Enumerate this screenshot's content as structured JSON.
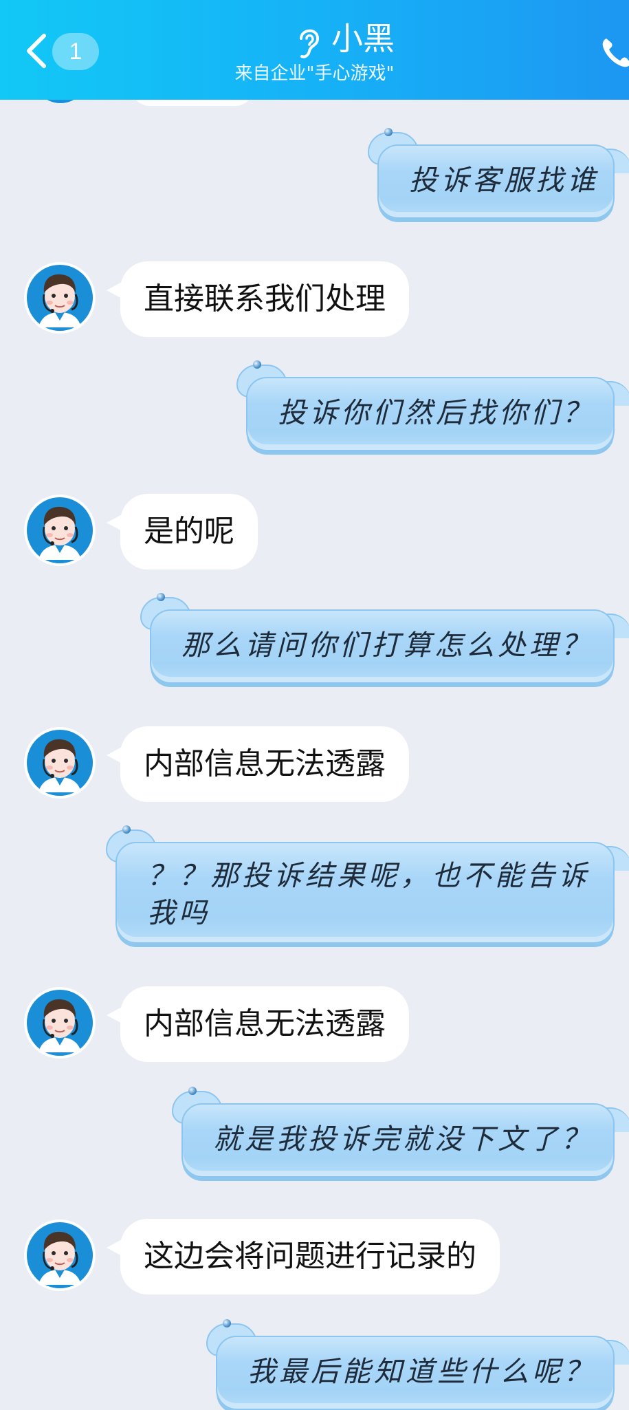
{
  "header": {
    "badge_count": "1",
    "title": "小黑",
    "subtitle": "来自企业\"手心游戏\""
  },
  "messages": [
    {
      "side": "out",
      "text": "投诉客服找谁"
    },
    {
      "side": "in",
      "text": "直接联系我们处理"
    },
    {
      "side": "out",
      "text": "投诉你们然后找你们？"
    },
    {
      "side": "in",
      "text": "是的呢"
    },
    {
      "side": "out",
      "text": "那么请问你们打算怎么处理？"
    },
    {
      "side": "in",
      "text": "内部信息无法透露"
    },
    {
      "side": "out",
      "text": "？？那投诉结果呢，也不能告诉我吗"
    },
    {
      "side": "in",
      "text": "内部信息无法透露"
    },
    {
      "side": "out",
      "text": "就是我投诉完就没下文了？"
    },
    {
      "side": "in",
      "text": "这边会将问题进行记录的"
    },
    {
      "side": "out",
      "text": "我最后能知道些什么呢？"
    }
  ],
  "colors": {
    "header_start": "#12c8f6",
    "header_end": "#1d97f2",
    "background": "#eaedf4",
    "out_bubble": "#a9d6f8",
    "in_bubble": "#ffffff"
  },
  "icons": {
    "back": "chevron-left-icon",
    "ear": "ear-icon",
    "phone": "phone-icon",
    "avatar": "customer-service-avatar"
  }
}
